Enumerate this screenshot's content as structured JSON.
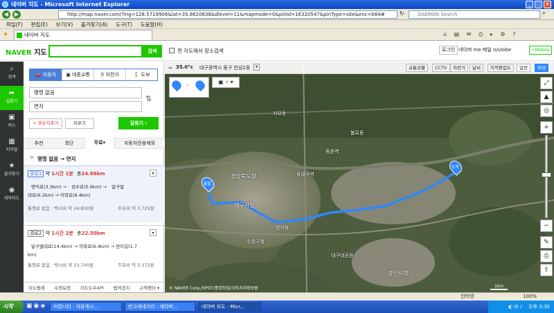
{
  "window": {
    "title": "네이버 지도 - Microsoft Internet Explorer"
  },
  "address": {
    "url": "http://map.naver.com/?lng=128.5719906&lat=35.8620638&dlevel=11&mapmode=0&pinId=16320547&pinType=site&enc=b64#",
    "search_placeholder": "DAEMON Search"
  },
  "menu": [
    "파일(F)",
    "편집(E)",
    "보기(V)",
    "즐겨찾기(A)",
    "도구(T)",
    "도움말(H)"
  ],
  "tab": {
    "label": "네이버 지도"
  },
  "header": {
    "logo": "NAVER",
    "logo_suffix": "지도",
    "search_button": "검색",
    "checkbox_label": "현 지도에서 장소검색",
    "login": "로그인",
    "user_links": "네이버  me  메일  n/ulobe",
    "mobile": "+Mobile"
  },
  "leftnav": [
    {
      "icon": "⌕",
      "label": "검색"
    },
    {
      "icon": "➦",
      "label": "길찾기"
    },
    {
      "icon": "▣",
      "label": "버스"
    },
    {
      "icon": "▦",
      "label": "지하철"
    },
    {
      "icon": "★",
      "label": "즐겨찾기"
    },
    {
      "icon": "◉",
      "label": "테마지도"
    }
  ],
  "modes": [
    "자동차",
    "대중교통",
    "자전거",
    "도보"
  ],
  "route": {
    "origin": "명령 없음",
    "destination": "연지",
    "add_waypoint": "+ 경유지추가",
    "reset": "지우기",
    "find": "길찾기 ›"
  },
  "tabs": [
    "추천",
    "최단",
    "무료▾",
    "자동차전용제외"
  ],
  "summary_title": "명령 없음 → 연지",
  "routes": [
    {
      "label": "경로1",
      "time_prefix": "약",
      "time": "1시간 1분",
      "dist_prefix": "총",
      "dist": "24.86km",
      "path_a": "명덕로(3.3km) →",
      "path_b": "성수로(5.6km) →",
      "path_c": "달구벌",
      "path_d": "대로(6.2km) → 이학로(6.4km)",
      "fare": "통행료 없음 · 택시비 약 24,800원",
      "fuel": "주유비 약 3,725원"
    },
    {
      "label": "경로2",
      "time_prefix": "약",
      "time": "1시간 2분",
      "dist_prefix": "총",
      "dist": "22.50km",
      "path_a": "달구벌대로(14.4km) → 이학로(6.4km) → 연지길(1.7",
      "path_d": "km)",
      "fare": "통행료 없음 · 택시비 약 23,700원",
      "fuel": "주유비 약 3,372원"
    }
  ],
  "footer_links": [
    "지도범례",
    "수정요청",
    "지도도우API",
    "법적공지",
    "고객센터 ▾"
  ],
  "map": {
    "weather": "35.0°c",
    "location": "대구광역시 동구 안심1동",
    "layer_buttons": [
      "교통상황",
      "CCTV",
      "자전거",
      "날씨",
      "지적편집도"
    ],
    "view_buttons": [
      "일반",
      "위성"
    ],
    "labels": [
      {
        "t": "경상북도청"
      },
      {
        "t": "대구시청"
      },
      {
        "t": "동대구역"
      },
      {
        "t": "경산시청"
      },
      {
        "t": "지묘동"
      },
      {
        "t": "불로동"
      },
      {
        "t": "동촌역"
      },
      {
        "t": "범어동"
      },
      {
        "t": "수성구청"
      },
      {
        "t": "대구대공원"
      }
    ],
    "start_label": "출발",
    "end_label": "도착",
    "copyright": "© NAVER Corp./SPOT/중앙항업/국토지리정보원",
    "scale": "1km"
  },
  "status": {
    "left": "",
    "zone": "인터넷",
    "zoom": "100%"
  },
  "taskbar": {
    "start": "시작",
    "items": [
      "커뮤니티 : 자유게시...",
      "반고게네거리 : 네이버...",
      "네이버 지도 - Micr..."
    ],
    "clock": "오후 3:30"
  }
}
